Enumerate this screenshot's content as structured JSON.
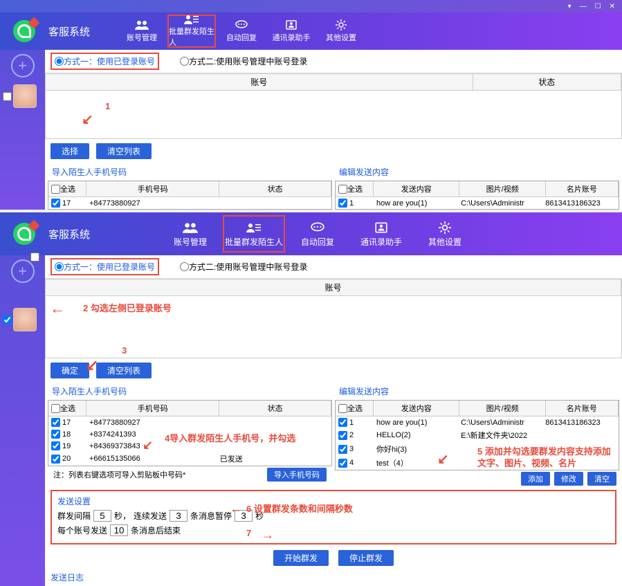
{
  "app": {
    "title": "客服系统"
  },
  "window": {
    "min": "—",
    "max": "☐",
    "close": "✕",
    "down": "▾"
  },
  "nav": {
    "account_mgmt": "账号管理",
    "bulk_send": "批量群发陌生人",
    "auto_reply": "自动回复",
    "contact_helper": "通讯录助手",
    "other_settings": "其他设置"
  },
  "mode": {
    "opt1": "方式一：使用已登录账号",
    "opt2": "方式二:使用账号管理中账号登录"
  },
  "table": {
    "account": "账号",
    "status": "状态"
  },
  "buttons": {
    "select": "选择",
    "confirm": "确定",
    "clear_list": "清空列表",
    "import_phone": "导入手机号码",
    "start_send": "开始群发",
    "stop_send": "停止群发",
    "add": "添加",
    "edit": "修改",
    "clear": "清空"
  },
  "panels": {
    "import_title": "导入陌生人手机号码",
    "edit_title": "编辑发送内容",
    "select_all": "全选",
    "phone_h": "手机号码",
    "status_h": "状态",
    "content_h": "发送内容",
    "media_h": "图片/视频",
    "card_h": "名片账号"
  },
  "rows1": {
    "r1_idx": "17",
    "r1_phone": "+84773880927",
    "r2_phone": "",
    "c1_idx": "1",
    "c1_content": "how are you(1)",
    "c1_media": "C:\\Users\\Administr",
    "c1_card": "8613413186323"
  },
  "rows2": {
    "r1_idx": "17",
    "r1_phone": "+84773880927",
    "r1_status": "",
    "r2_idx": "18",
    "r2_phone": "+8374241393",
    "r2_status": "",
    "r3_idx": "19",
    "r3_phone": "+84369373843",
    "r3_status": "",
    "r4_idx": "20",
    "r4_phone": "+66615135066",
    "r4_status": "已发送",
    "c1_idx": "1",
    "c1_content": "how are you(1)",
    "c1_media": "C:\\Users\\Administr",
    "c1_card": "8613413186323",
    "c2_idx": "2",
    "c2_content": "HELLO(2)",
    "c2_media": "E:\\新建文件夹\\2022",
    "c2_card": "",
    "c3_idx": "3",
    "c3_content": "你好hi(3)",
    "c3_media": "",
    "c3_card": "",
    "c4_idx": "4",
    "c4_content": "test（4）",
    "c4_media": "",
    "c4_card": ""
  },
  "note": "注：列表右键选项可导入剪贴板中号码*",
  "settings": {
    "title": "发送设置",
    "interval_label": "群发间隔",
    "interval_val": "5",
    "sec": "秒，",
    "cont_send": "连续发送",
    "cont_val": "3",
    "pause_label": "条消息暂停",
    "pause_val": "3",
    "sec2": "秒",
    "per_account": "每个账号发送",
    "per_val": "10",
    "end_label": "条消息后结束"
  },
  "log_title": "发送日志",
  "annotations": {
    "a1": "1",
    "a2": "2 勾选左侧已登录账号",
    "a3": "3",
    "a4": "4导入群发陌生人手机号，并勾选",
    "a5": "5 添加并勾选要群发内容支持添加文字、图片、视频、名片",
    "a6": "6 设置群发条数和间隔秒数",
    "a7": "7"
  }
}
